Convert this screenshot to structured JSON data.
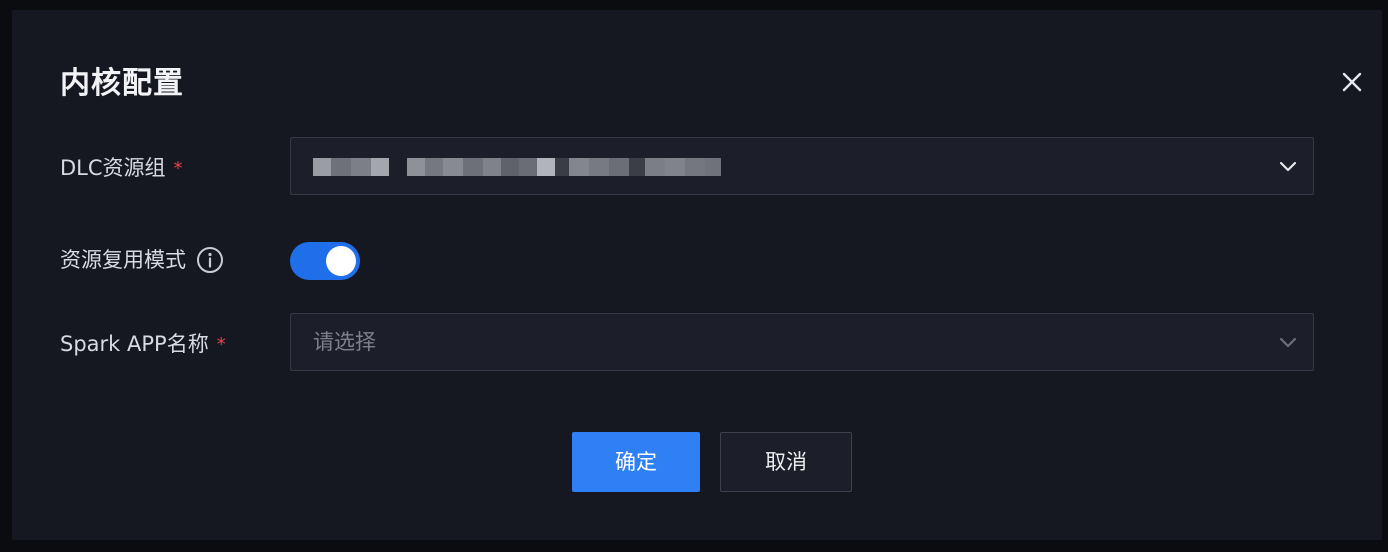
{
  "dialog": {
    "title": "内核配置",
    "close_icon": "close-icon"
  },
  "form": {
    "resource_group": {
      "label": "DLC资源组",
      "required_mark": "*",
      "value_redacted": true
    },
    "reuse_mode": {
      "label": "资源复用模式",
      "info_icon": "info-icon",
      "enabled": true
    },
    "spark_app": {
      "label": "Spark APP名称",
      "required_mark": "*",
      "placeholder": "请选择"
    }
  },
  "footer": {
    "confirm_label": "确定",
    "cancel_label": "取消"
  },
  "colors": {
    "accent": "#2f7ff5",
    "toggle_on": "#1f6feb",
    "required": "#e54545",
    "dialog_bg": "#151821"
  }
}
